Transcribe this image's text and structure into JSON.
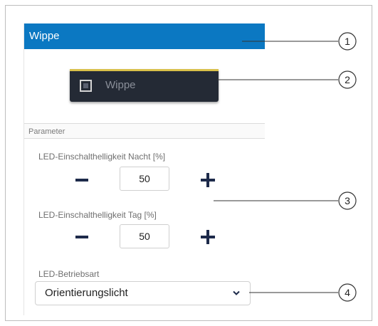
{
  "panel": {
    "title": "Wippe",
    "widget_label": "Wippe",
    "section_title": "Parameter"
  },
  "params": [
    {
      "label": "LED-Einschalthelligkeit Nacht [%]",
      "value": "50"
    },
    {
      "label": "LED-Einschalthelligkeit Tag [%]",
      "value": "50"
    }
  ],
  "mode": {
    "label": "LED-Betriebsart",
    "selected": "Orientierungslicht"
  },
  "callouts": [
    "1",
    "2",
    "3",
    "4"
  ],
  "colors": {
    "header": "#0b78c2",
    "widget": "#242a35",
    "accent": "#d9c04a",
    "icon": "#1d2a4a"
  }
}
